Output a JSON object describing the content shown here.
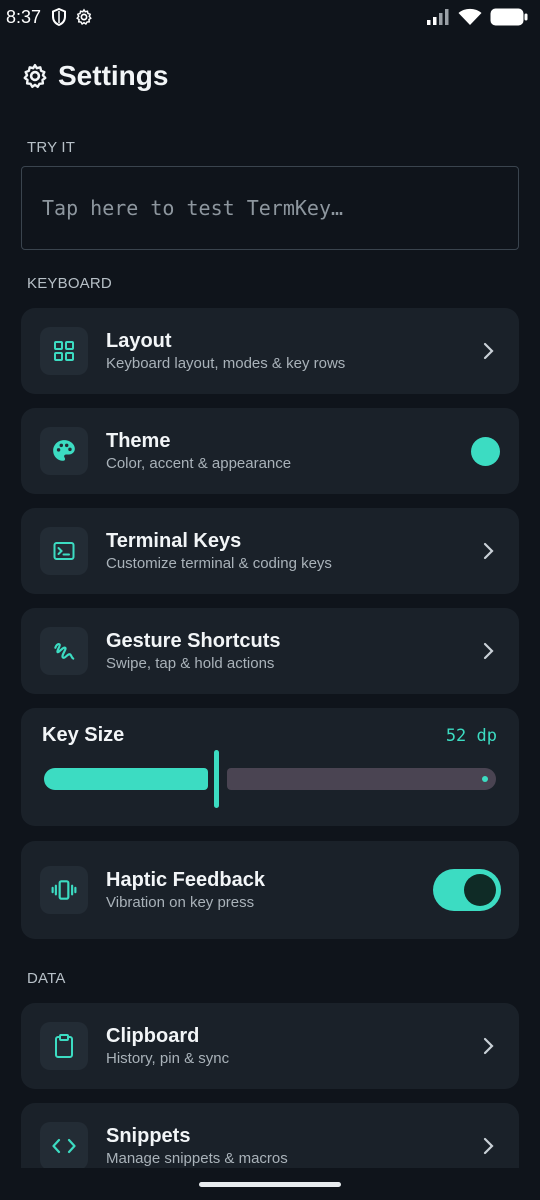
{
  "status": {
    "time": "8:37",
    "icons_left": [
      "shield-icon",
      "gear-icon"
    ],
    "icons_right": [
      "signal-icon",
      "wifi-icon",
      "battery-icon"
    ]
  },
  "header": {
    "title": "Settings",
    "icon": "gear-icon"
  },
  "try_it": {
    "label": "TRY IT",
    "placeholder": "Tap here to test TermKey…"
  },
  "sections": {
    "keyboard": "KEYBOARD",
    "data": "DATA"
  },
  "items": {
    "layout": {
      "title": "Layout",
      "subtitle": "Keyboard layout, modes & key rows",
      "icon": "grid-icon"
    },
    "theme": {
      "title": "Theme",
      "subtitle": "Color, accent & appearance",
      "icon": "palette-icon",
      "accent": "#3cdcc2"
    },
    "terminal": {
      "title": "Terminal Keys",
      "subtitle": "Customize terminal & coding keys",
      "icon": "terminal-icon"
    },
    "gestures": {
      "title": "Gesture Shortcuts",
      "subtitle": "Swipe, tap & hold actions",
      "icon": "gesture-icon"
    },
    "haptic": {
      "title": "Haptic Feedback",
      "subtitle": "Vibration on key press",
      "icon": "vibration-icon",
      "enabled": true
    },
    "clipboard": {
      "title": "Clipboard",
      "subtitle": "History, pin & sync",
      "icon": "clipboard-icon"
    },
    "snippets": {
      "title": "Snippets",
      "subtitle": "Manage snippets & macros",
      "icon": "code-icon"
    }
  },
  "key_size": {
    "title": "Key Size",
    "value_label": "52 dp",
    "fraction": 0.38
  },
  "colors": {
    "accent": "#3cdcc2",
    "background": "#0f141b",
    "card": "#1a2129"
  }
}
